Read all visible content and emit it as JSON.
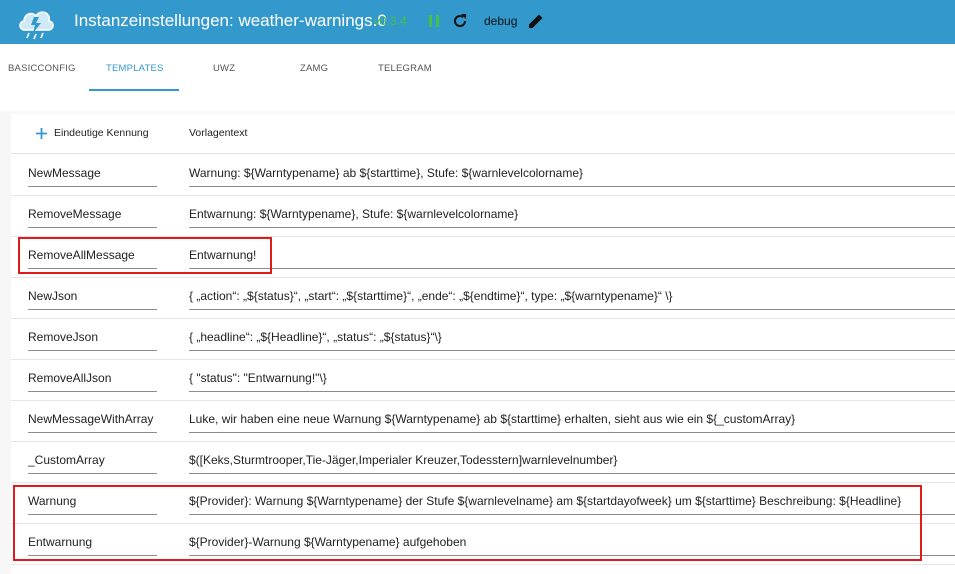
{
  "header": {
    "title": "Instanzeinstellungen: weather-warnings.0",
    "version": "v0.3.4",
    "debug_label": "debug",
    "icons": [
      "pause-icon",
      "reload-icon",
      "edit-icon"
    ],
    "colors": {
      "bar": "#3399cc",
      "version": "#46c046",
      "accent": "#3399cc"
    }
  },
  "tabs": [
    {
      "label": "BASICCONFIG",
      "active": false
    },
    {
      "label": "TEMPLATES",
      "active": true
    },
    {
      "label": "UWZ",
      "active": false
    },
    {
      "label": "ZAMG",
      "active": false
    },
    {
      "label": "TELEGRAM",
      "active": false
    }
  ],
  "table": {
    "add_label": "Eindeutige Kennung",
    "value_header": "Vorlagentext",
    "rows": [
      {
        "key": "NewMessage",
        "value": "Warnung: ${Warntypename} ab ${starttime}, Stufe: ${warnlevelcolorname}"
      },
      {
        "key": "RemoveMessage",
        "value": "Entwarnung: ${Warntypename}, Stufe: ${warnlevelcolorname}"
      },
      {
        "key": "RemoveAllMessage",
        "value": "Entwarnung!"
      },
      {
        "key": "NewJson",
        "value": "{ „action“: „${status}“, „start“: „${starttime}“, „ende“: „${endtime}“, type: „${warntypename}“ \\}"
      },
      {
        "key": "RemoveJson",
        "value": "{ „headline“: „${Headline}“, „status“: „${status}“\\}"
      },
      {
        "key": "RemoveAllJson",
        "value": "{ \"status\": \"Entwarnung!\"\\}"
      },
      {
        "key": "NewMessageWithArray",
        "value": "Luke, wir haben eine neue Warnung ${Warntypename} ab ${starttime} erhalten, sieht aus wie ein ${_customArray}"
      },
      {
        "key": "_CustomArray",
        "value": "$([Keks,Sturmtrooper,Tie-Jäger,Imperialer Kreuzer,Todesstern]warnlevelnumber}"
      },
      {
        "key": "Warnung",
        "value": "${Provider}: Warnung ${Warntypename} der Stufe ${warnlevelname} am ${startdayofweek} um ${starttime} Beschreibung: ${Headline}"
      },
      {
        "key": "Entwarnung",
        "value": "${Provider}-Warnung ${Warntypename} aufgehoben"
      }
    ]
  }
}
